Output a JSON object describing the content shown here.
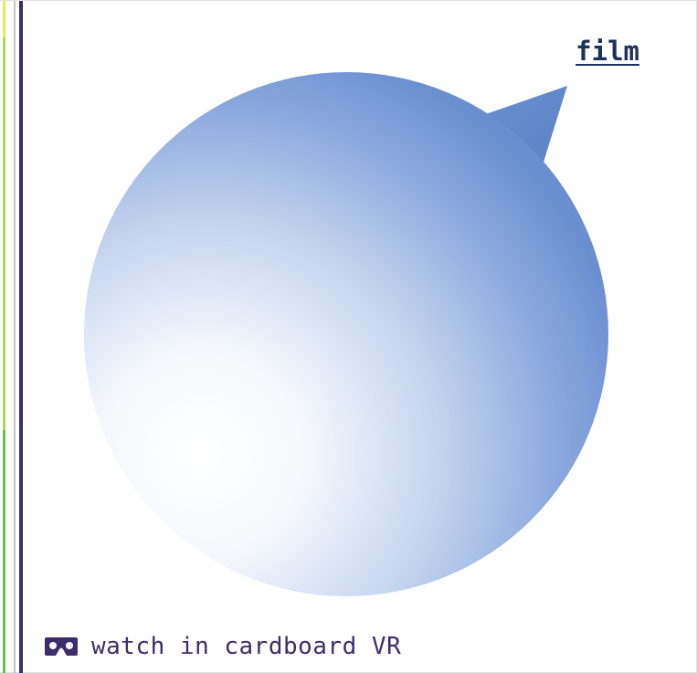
{
  "header": {
    "film_link": "film"
  },
  "footer": {
    "vr_label": "watch in cardboard VR",
    "vr_icon": "cardboard-vr-icon"
  },
  "colors": {
    "bubble_dark": "#6a8fd0",
    "bubble_light": "#ffffff",
    "text_purple": "#3d2d6b",
    "link_navy": "#1e3060"
  }
}
